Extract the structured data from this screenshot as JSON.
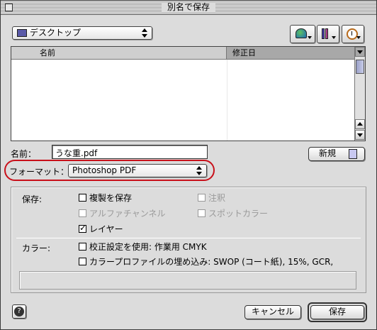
{
  "window": {
    "title": "別名で保存"
  },
  "location": {
    "selected": "デスクトップ"
  },
  "toolbar": {
    "icons": [
      "computer-icon",
      "shortcuts-icon",
      "recent-icon"
    ]
  },
  "browser": {
    "columns": [
      "名前",
      "修正日"
    ]
  },
  "name_field": {
    "label": "名前：",
    "value": "うな重.pdf"
  },
  "new_folder_button": {
    "label": "新規"
  },
  "format": {
    "label": "フォーマット：",
    "selected": "Photoshop PDF"
  },
  "save_options": {
    "label": "保存:",
    "items": [
      {
        "label": "複製を保存",
        "checked": false,
        "enabled": true
      },
      {
        "label": "注釈",
        "checked": false,
        "enabled": false
      },
      {
        "label": "アルファチャンネル",
        "checked": false,
        "enabled": false
      },
      {
        "label": "スポットカラー",
        "checked": false,
        "enabled": false
      },
      {
        "label": "レイヤー",
        "checked": true,
        "enabled": true
      }
    ]
  },
  "color_options": {
    "label": "カラー:",
    "items": [
      {
        "label": "校正設定を使用: 作業用 CMYK",
        "checked": false,
        "enabled": true
      },
      {
        "label": "カラープロファイルの埋め込み: SWOP (コート紙), 15%, GCR,",
        "checked": false,
        "enabled": true
      }
    ]
  },
  "buttons": {
    "cancel": "キャンセル",
    "save": "保存"
  },
  "colors": {
    "highlight_ring": "#c8101a"
  }
}
